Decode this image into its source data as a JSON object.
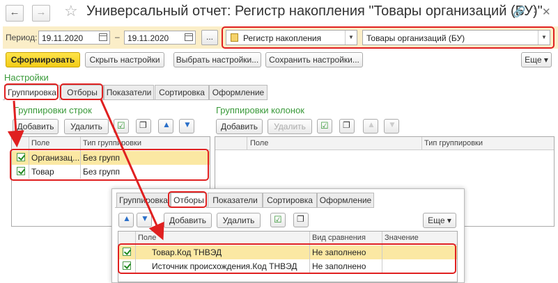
{
  "window": {
    "title": "Универсальный отчет: Регистр накопления \"Товары организаций (БУ)\"",
    "back_icon": "arrow-left-icon",
    "forward_icon": "arrow-right-icon",
    "favorite_icon": "star-icon"
  },
  "period": {
    "label": "Период:",
    "from": "19.11.2020",
    "dash": "–",
    "to": "19.11.2020",
    "dots_label": "...",
    "source_type": "Регистр накопления",
    "source_name": "Товары организаций (БУ)"
  },
  "toolbar": {
    "generate": "Сформировать",
    "hide_settings": "Скрыть настройки",
    "choose_settings": "Выбрать настройки...",
    "save_settings": "Сохранить настройки...",
    "more": "Еще"
  },
  "settings": {
    "title": "Настройки",
    "tabs": [
      "Группировка",
      "Отборы",
      "Показатели",
      "Сортировка",
      "Оформление"
    ],
    "row_groups": {
      "title": "Группировки строк",
      "add": "Добавить",
      "delete": "Удалить",
      "columns": [
        "Поле",
        "Тип группировки"
      ],
      "rows": [
        {
          "field": "Организац...",
          "type": "Без групп",
          "checked": true
        },
        {
          "field": "Товар",
          "type": "Без групп",
          "checked": true
        }
      ]
    },
    "col_groups": {
      "title": "Группировки колонок",
      "add": "Добавить",
      "delete": "Удалить",
      "columns": [
        "Поле",
        "Тип группировки"
      ]
    }
  },
  "popup": {
    "tabs": [
      "Группировка",
      "Отборы",
      "Показатели",
      "Сортировка",
      "Оформление"
    ],
    "add": "Добавить",
    "delete": "Удалить",
    "more": "Еще",
    "columns": [
      "Поле",
      "Вид сравнения",
      "Значение"
    ],
    "rows": [
      {
        "field": "Товар.Код ТНВЭД",
        "comparison": "Не заполнено",
        "value": "",
        "checked": true
      },
      {
        "field": "Источник происхождения.Код ТНВЭД",
        "comparison": "Не заполнено",
        "value": "",
        "checked": true
      }
    ]
  },
  "colors": {
    "highlight": "#e02020",
    "accent_yellow": "#f2cc17",
    "green": "#3a9a3a"
  }
}
